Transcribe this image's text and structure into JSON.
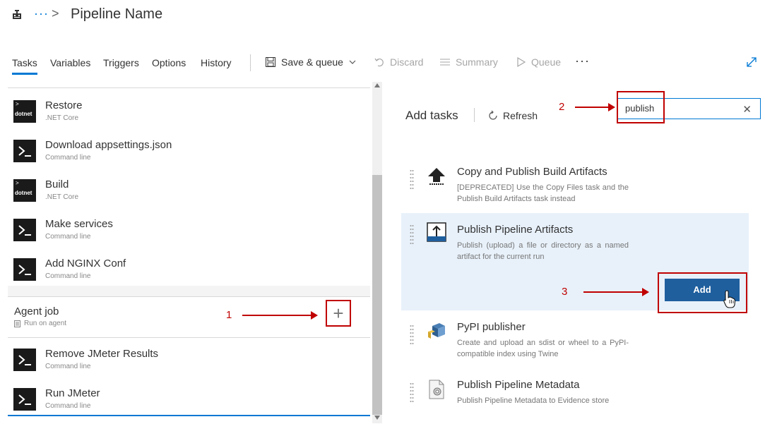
{
  "header": {
    "breadcrumb_more": "···",
    "breadcrumb_sep": ">",
    "title": "Pipeline Name"
  },
  "tabs": [
    {
      "label": "Tasks",
      "active": true
    },
    {
      "label": "Variables"
    },
    {
      "label": "Triggers"
    },
    {
      "label": "Options"
    },
    {
      "label": "History"
    }
  ],
  "toolbar": {
    "save_queue": "Save & queue",
    "discard": "Discard",
    "summary": "Summary",
    "queue": "Queue",
    "more": "···"
  },
  "left_tasks": [
    {
      "name": "Restore",
      "sub": ".NET Core",
      "icon": "dotnet"
    },
    {
      "name": "Download appsettings.json",
      "sub": "Command line",
      "icon": "cmd"
    },
    {
      "name": "Build",
      "sub": ".NET Core",
      "icon": "dotnet"
    },
    {
      "name": "Make services",
      "sub": "Command line",
      "icon": "cmd"
    },
    {
      "name": "Add NGINX Conf",
      "sub": "Command line",
      "icon": "cmd"
    }
  ],
  "agent_job": {
    "title": "Agent job",
    "subtitle": "Run on agent",
    "add_label": "+"
  },
  "agent_tasks": [
    {
      "name": "Remove JMeter Results",
      "sub": "Command line",
      "icon": "cmd"
    },
    {
      "name": "Run JMeter",
      "sub": "Command line",
      "icon": "cmd"
    }
  ],
  "dotnet_label": "dotnet",
  "add_tasks": {
    "title": "Add tasks",
    "refresh": "Refresh",
    "search_value": "publish",
    "clear": "✕"
  },
  "results": [
    {
      "title": "Copy and Publish Build Artifacts",
      "desc": "[DEPRECATED] Use the Copy Files task and the Publish Build Artifacts task instead"
    },
    {
      "title": "Publish Pipeline Artifacts",
      "desc": "Publish (upload) a file or directory as a named artifact for the current run",
      "selected": true
    },
    {
      "title": "PyPI publisher",
      "desc": "Create and upload an sdist or wheel to a PyPI-compatible index using Twine"
    },
    {
      "title": "Publish Pipeline Metadata",
      "desc": "Publish Pipeline Metadata to Evidence store"
    }
  ],
  "add_button": "Add",
  "annotations": {
    "one": "1",
    "two": "2",
    "three": "3"
  },
  "colors": {
    "accent": "#0078d4",
    "annotation": "#c00000",
    "add_button": "#1f5f9e",
    "selected_row": "#e8f1fa"
  }
}
